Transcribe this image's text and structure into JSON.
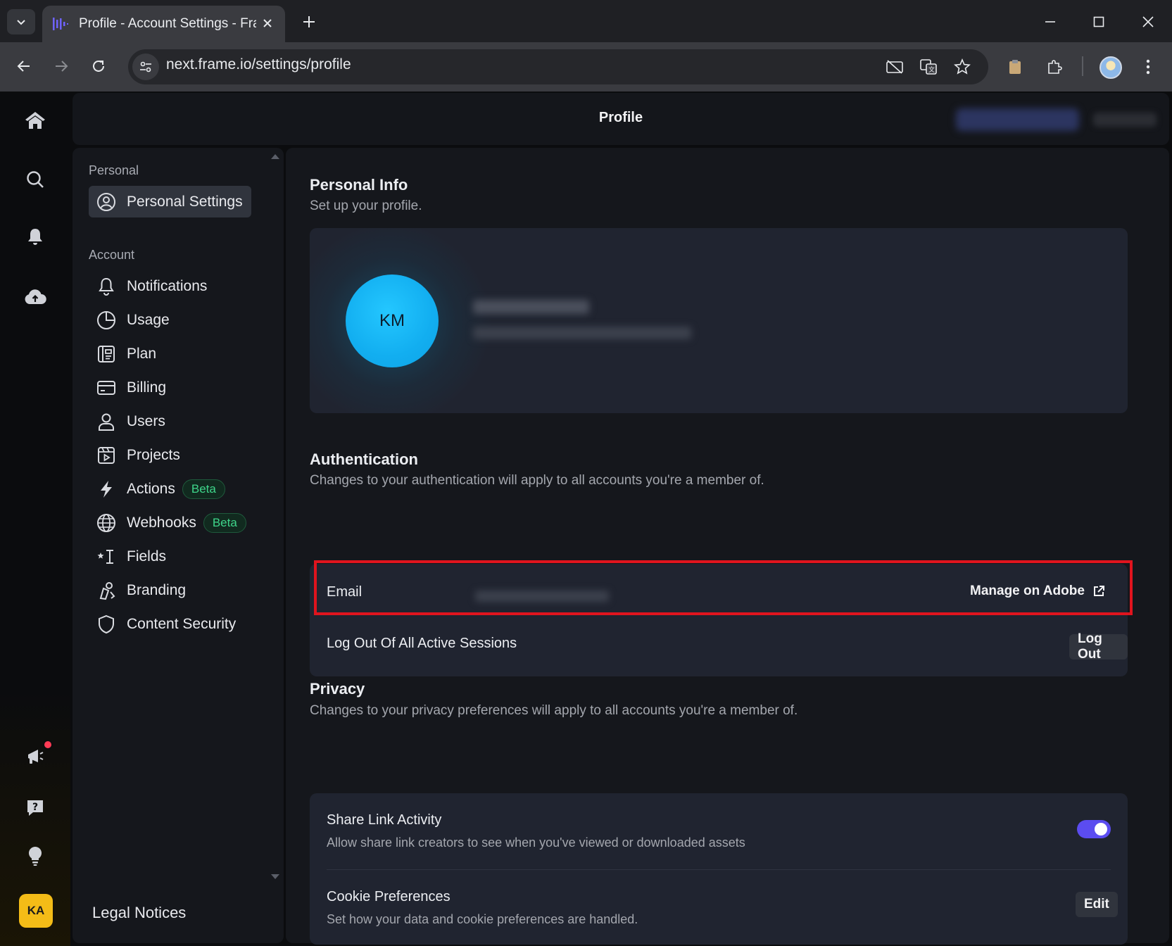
{
  "browser": {
    "tab_title": "Profile - Account Settings - Frame.io",
    "url": "next.frame.io/settings/profile"
  },
  "header": {
    "title": "Profile"
  },
  "rail": {
    "user_initials": "KA"
  },
  "settings_nav": {
    "personal_section": "Personal",
    "personal_items": [
      {
        "label": "Personal Settings",
        "icon": "user-circle-icon",
        "active": true
      }
    ],
    "account_section": "Account",
    "account_items": [
      {
        "label": "Notifications",
        "icon": "bell-icon"
      },
      {
        "label": "Usage",
        "icon": "pie-chart-icon"
      },
      {
        "label": "Plan",
        "icon": "plan-icon"
      },
      {
        "label": "Billing",
        "icon": "credit-card-icon"
      },
      {
        "label": "Users",
        "icon": "user-icon"
      },
      {
        "label": "Projects",
        "icon": "projects-icon"
      },
      {
        "label": "Actions",
        "icon": "lightning-icon",
        "badge": "Beta"
      },
      {
        "label": "Webhooks",
        "icon": "globe-icon",
        "badge": "Beta"
      },
      {
        "label": "Fields",
        "icon": "fields-icon"
      },
      {
        "label": "Branding",
        "icon": "branding-icon"
      },
      {
        "label": "Content Security",
        "icon": "shield-icon"
      }
    ],
    "legal": "Legal Notices"
  },
  "personal_info": {
    "title": "Personal Info",
    "subtitle": "Set up your profile.",
    "avatar_initials": "KM"
  },
  "authentication": {
    "title": "Authentication",
    "subtitle": "Changes to your authentication will apply to all accounts you're a member of.",
    "email_label": "Email",
    "manage_link": "Manage on Adobe",
    "logout_label": "Log Out Of All Active Sessions",
    "logout_button": "Log Out"
  },
  "privacy": {
    "title": "Privacy",
    "subtitle": "Changes to your privacy preferences will apply to all accounts you're a member of.",
    "share_title": "Share Link Activity",
    "share_desc": "Allow share link creators to see when you've viewed or downloaded assets",
    "share_enabled": true,
    "cookie_title": "Cookie Preferences",
    "cookie_desc": "Set how your data and cookie preferences are handled.",
    "cookie_button": "Edit"
  },
  "colors": {
    "accent": "#5b4cf0",
    "avatar": "#12aef0",
    "beta_badge": "#3ed58a",
    "highlight": "#e0141e",
    "rail_avatar": "#f4bc17"
  }
}
